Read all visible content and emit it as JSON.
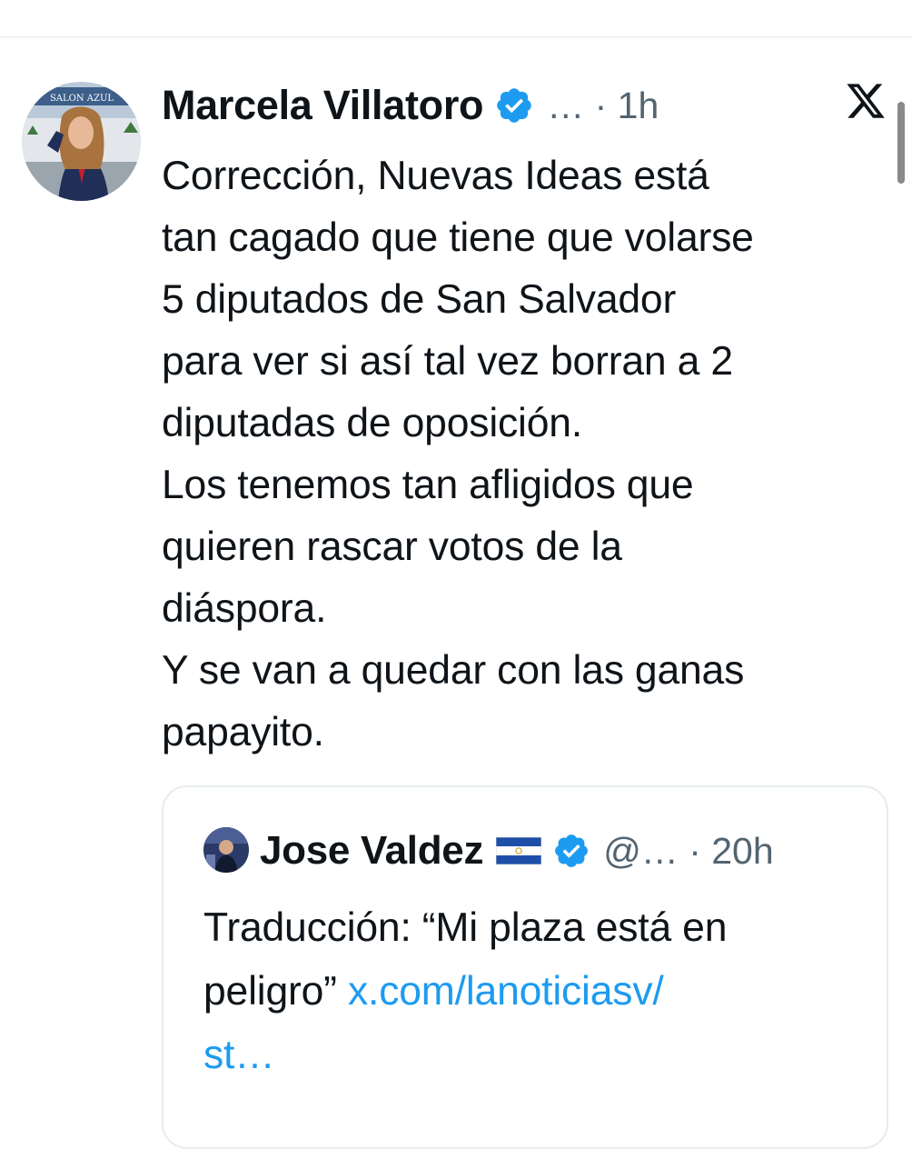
{
  "tweet": {
    "author": {
      "display_name": "Marcela Villatoro",
      "avatar_sign_text": "SALON AZUL"
    },
    "meta": "… · 1h",
    "body_lines": [
      "Corrección, Nuevas Ideas está",
      "tan cagado que tiene que volarse",
      "5 diputados de San Salvador",
      "para ver si así tal vez borran a 2",
      "diputadas de oposición.",
      "Los tenemos tan afligidos que",
      "quieren rascar votos de la",
      "diáspora.",
      "Y se van a quedar con las ganas",
      "papayito."
    ],
    "platform_icon": "x-logo-icon",
    "verified_icon": "verified-badge-icon"
  },
  "quoted_tweet": {
    "author": {
      "display_name": "Jose Valdez",
      "flag_icon": "el-salvador-flag-icon"
    },
    "meta": "@… · 20h",
    "text_line_1": "Traducción: “Mi plaza está en",
    "text_line_2_prefix": "peligro” ",
    "link_line_1": "x.com/lanoticiasv/",
    "link_line_2": "st…"
  },
  "colors": {
    "text": "#0f1419",
    "secondary_text": "#536471",
    "link": "#1d9bf0",
    "verified": "#1d9bf0",
    "border": "#e6ecf0"
  }
}
